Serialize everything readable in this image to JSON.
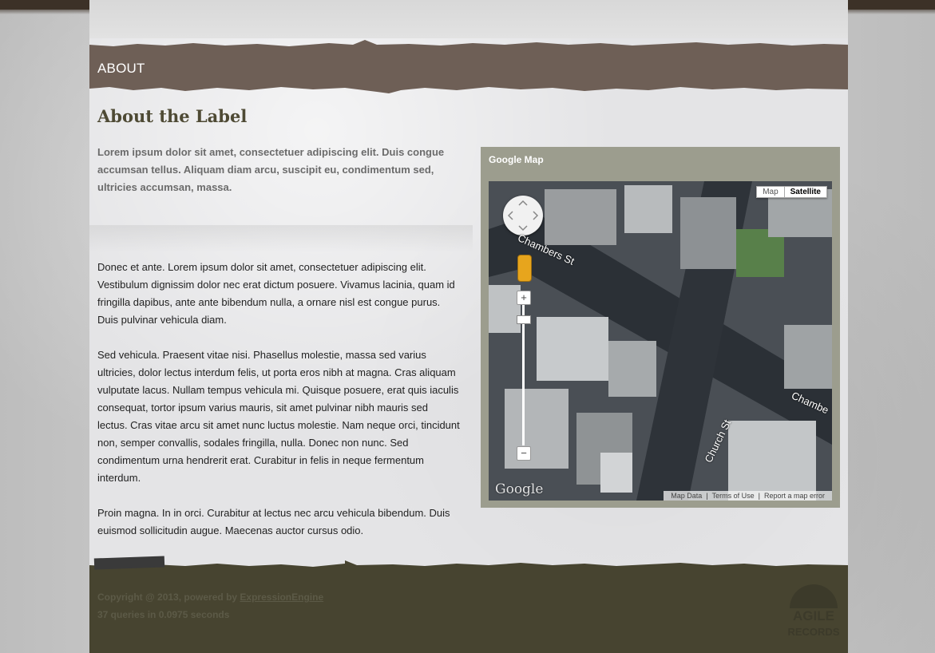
{
  "header": {
    "section_title": "ABOUT"
  },
  "main": {
    "heading": "About the Label",
    "intro": "Lorem ipsum dolor sit amet, consectetuer adipiscing elit. Duis congue accumsan tellus. Aliquam diam arcu, suscipit eu, condimentum sed, ultricies accumsan, massa.",
    "paragraphs": [
      "Donec et ante. Lorem ipsum dolor sit amet, consectetuer adipiscing elit. Vestibulum dignissim dolor nec erat dictum posuere. Vivamus lacinia, quam id fringilla dapibus, ante ante bibendum nulla, a ornare nisl est congue purus. Duis pulvinar vehicula diam.",
      "Sed vehicula. Praesent vitae nisi. Phasellus molestie, massa sed varius ultricies, dolor lectus interdum felis, ut porta eros nibh at magna. Cras aliquam vulputate lacus. Nullam tempus vehicula mi. Quisque posuere, erat quis iaculis consequat, tortor ipsum varius mauris, sit amet pulvinar nibh mauris sed lectus. Cras vitae arcu sit amet nunc luctus molestie. Nam neque orci, tincidunt non, semper convallis, sodales fringilla, nulla. Donec non nunc. Sed condimentum urna hendrerit erat. Curabitur in felis in neque fermentum interdum.",
      "Proin magna. In in orci. Curabitur at lectus nec arcu vehicula bibendum. Duis euismod sollicitudin augue. Maecenas auctor cursus odio."
    ]
  },
  "map": {
    "title": "Google Map",
    "type_map": "Map",
    "type_satellite": "Satellite",
    "selected_type": "Satellite",
    "zoom_in": "+",
    "zoom_out": "−",
    "streets": [
      "Chambers St",
      "Church St",
      "Chambe"
    ],
    "logo": "Google",
    "footer": {
      "map_data": "Map Data",
      "terms": "Terms of Use",
      "report": "Report a map error"
    }
  },
  "footer": {
    "copyright_prefix": "Copyright @ 2013, powered by",
    "engine_link": "ExpressionEngine",
    "queries": "37 queries in 0.0975 seconds",
    "logo_line1": "AGILE",
    "logo_line2": "RECORDS"
  },
  "colors": {
    "header_band": "#6e5f56",
    "heading": "#4e4a34",
    "footer_band": "#474430",
    "map_frame": "#9c9d8e"
  }
}
